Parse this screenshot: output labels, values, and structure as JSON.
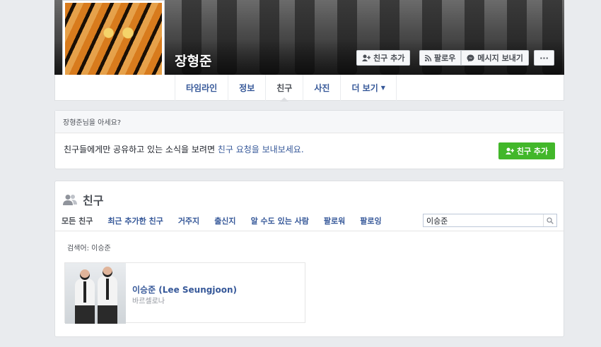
{
  "profile": {
    "name": "장형준",
    "actions": {
      "add_friend": "친구 추가",
      "follow": "팔로우",
      "message": "메시지 보내기",
      "more": "···"
    }
  },
  "nav": {
    "tabs": [
      {
        "label": "타임라인"
      },
      {
        "label": "정보"
      },
      {
        "label": "친구"
      },
      {
        "label": "사진"
      },
      {
        "label": "더 보기"
      }
    ]
  },
  "know_card": {
    "header": "장형준님을 아세요?",
    "message_prefix": "친구들에게만 공유하고 있는 소식을 보려면 ",
    "message_link": "친구 요청을 보내보세요.",
    "add_friend_button": "친구 추가"
  },
  "friends": {
    "title": "친구",
    "tabs": [
      {
        "label": "모든 친구"
      },
      {
        "label": "최근 추가한 친구"
      },
      {
        "label": "거주지"
      },
      {
        "label": "출신지"
      },
      {
        "label": "알 수도 있는 사람"
      },
      {
        "label": "팔로워"
      },
      {
        "label": "팔로잉"
      }
    ],
    "search_value": "이승준",
    "search_label": "검색어: 이승준",
    "results": [
      {
        "name": "이승준 (Lee Seungjoon)",
        "subtitle": "바르셀로나"
      }
    ]
  },
  "colors": {
    "link": "#365899",
    "green_button": "#42b72a",
    "background": "#e9ebee"
  }
}
